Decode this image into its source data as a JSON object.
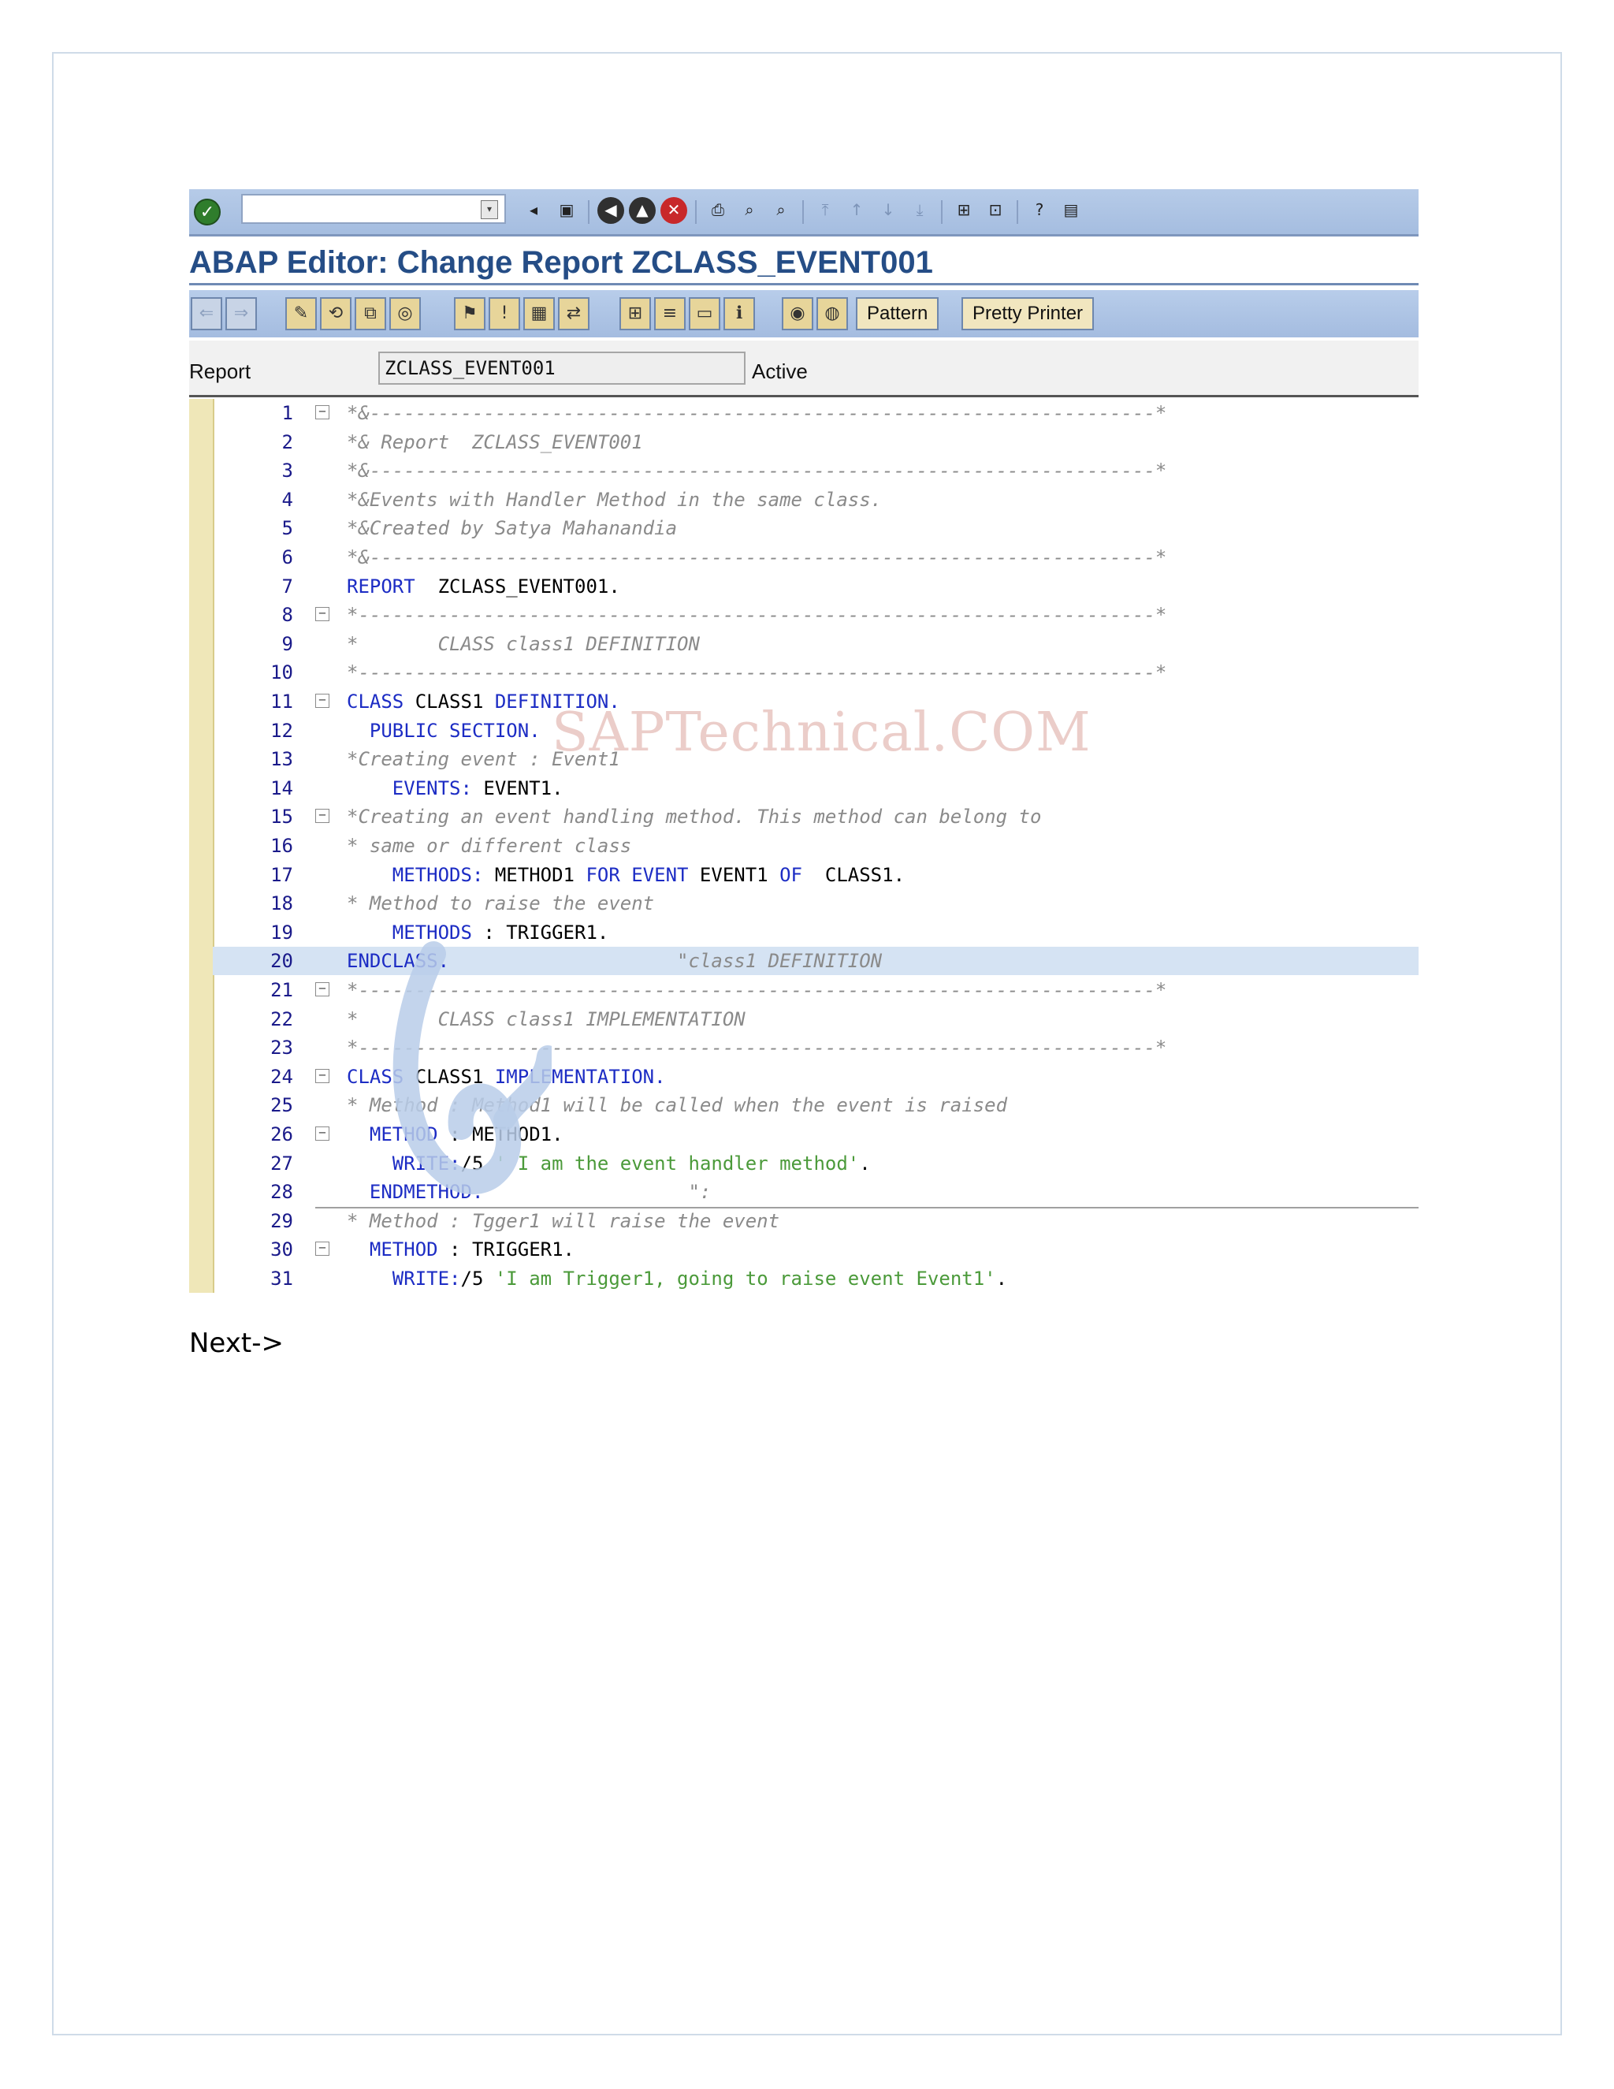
{
  "title": "ABAP Editor: Change Report ZCLASS_EVENT001",
  "toolbar": {
    "pattern_label": "Pattern",
    "pretty_printer_label": "Pretty Printer"
  },
  "report": {
    "label": "Report",
    "name": "ZCLASS_EVENT001",
    "status": "Active"
  },
  "watermark": "SAPTechnical.COM",
  "next_link": "Next->",
  "icons": {
    "system": [
      "enter-icon",
      "command-field-dropdown-icon",
      "back-nav-icon",
      "save-icon",
      "back-icon",
      "exit-icon",
      "cancel-icon",
      "print-icon",
      "find-icon",
      "find-next-icon",
      "first-page-icon",
      "prev-page-icon",
      "next-page-icon",
      "last-page-icon",
      "new-session-icon",
      "shortcut-icon",
      "help-icon",
      "layout-menu-icon"
    ],
    "application": [
      "back-arrow-icon",
      "forward-arrow-icon",
      "display-change-icon",
      "active-inactive-icon",
      "other-object-icon",
      "check-icon",
      "activate-icon",
      "test-icon",
      "where-used-icon",
      "object-list-icon",
      "navigation-window-icon",
      "enhance-icon",
      "breakpoint-icon",
      "set-breakpoint-icon",
      "stop-icon"
    ]
  },
  "colors": {
    "keyword": "#1c2cc4",
    "comment": "#8a8a8a",
    "string": "#4b9a3a",
    "title": "#254d86",
    "toolbar": "#a5bde0"
  },
  "code_lines": [
    {
      "n": "1",
      "fold": "⊟",
      "highlight": false,
      "tokens": [
        {
          "t": "c",
          "s": "*&---------------------------------------------------------------------*"
        }
      ]
    },
    {
      "n": "2",
      "fold": "",
      "highlight": false,
      "tokens": [
        {
          "t": "c",
          "s": "*& Report  ZCLASS_EVENT001"
        }
      ]
    },
    {
      "n": "3",
      "fold": "",
      "highlight": false,
      "tokens": [
        {
          "t": "c",
          "s": "*&---------------------------------------------------------------------*"
        }
      ]
    },
    {
      "n": "4",
      "fold": "",
      "highlight": false,
      "tokens": [
        {
          "t": "c",
          "s": "*&Events with Handler Method in the same class."
        }
      ]
    },
    {
      "n": "5",
      "fold": "",
      "highlight": false,
      "tokens": [
        {
          "t": "c",
          "s": "*&Created by Satya Mahanandia"
        }
      ]
    },
    {
      "n": "6",
      "fold": "",
      "highlight": false,
      "tokens": [
        {
          "t": "c",
          "s": "*&---------------------------------------------------------------------*"
        }
      ]
    },
    {
      "n": "7",
      "fold": "",
      "highlight": false,
      "tokens": [
        {
          "t": "k",
          "s": "REPORT"
        },
        {
          "t": "i",
          "s": "  ZCLASS_EVENT001."
        }
      ]
    },
    {
      "n": "8",
      "fold": "⊟",
      "highlight": false,
      "tokens": [
        {
          "t": "c",
          "s": "*----------------------------------------------------------------------*"
        }
      ]
    },
    {
      "n": "9",
      "fold": "",
      "highlight": false,
      "tokens": [
        {
          "t": "c",
          "s": "*       CLASS class1 DEFINITION"
        }
      ]
    },
    {
      "n": "10",
      "fold": "",
      "highlight": false,
      "tokens": [
        {
          "t": "c",
          "s": "*----------------------------------------------------------------------*"
        }
      ]
    },
    {
      "n": "11",
      "fold": "⊟",
      "highlight": false,
      "tokens": [
        {
          "t": "k",
          "s": "CLASS"
        },
        {
          "t": "i",
          "s": " CLASS1 "
        },
        {
          "t": "k",
          "s": "DEFINITION."
        }
      ]
    },
    {
      "n": "12",
      "fold": "",
      "highlight": false,
      "tokens": [
        {
          "t": "k",
          "s": "  PUBLIC SECTION."
        }
      ]
    },
    {
      "n": "13",
      "fold": "",
      "highlight": false,
      "tokens": [
        {
          "t": "c",
          "s": "*Creating event : Event1"
        }
      ]
    },
    {
      "n": "14",
      "fold": "",
      "highlight": false,
      "tokens": [
        {
          "t": "k",
          "s": "    EVENTS:"
        },
        {
          "t": "i",
          "s": " EVENT1."
        }
      ]
    },
    {
      "n": "15",
      "fold": "⊟",
      "highlight": false,
      "tokens": [
        {
          "t": "c",
          "s": "*Creating an event handling method. This method can belong to"
        }
      ]
    },
    {
      "n": "16",
      "fold": "",
      "highlight": false,
      "tokens": [
        {
          "t": "c",
          "s": "* same or different class"
        }
      ]
    },
    {
      "n": "17",
      "fold": "",
      "highlight": false,
      "tokens": [
        {
          "t": "k",
          "s": "    METHODS:"
        },
        {
          "t": "i",
          "s": " METHOD1 "
        },
        {
          "t": "k",
          "s": "FOR EVENT"
        },
        {
          "t": "i",
          "s": " EVENT1 "
        },
        {
          "t": "k",
          "s": "OF"
        },
        {
          "t": "i",
          "s": "  CLASS1."
        }
      ]
    },
    {
      "n": "18",
      "fold": "",
      "highlight": false,
      "tokens": [
        {
          "t": "c",
          "s": "* Method to raise the event"
        }
      ]
    },
    {
      "n": "19",
      "fold": "",
      "highlight": false,
      "tokens": [
        {
          "t": "k",
          "s": "    METHODS"
        },
        {
          "t": "i",
          "s": " : TRIGGER1."
        }
      ]
    },
    {
      "n": "20",
      "fold": "",
      "highlight": true,
      "tokens": [
        {
          "t": "k",
          "s": "ENDCLASS."
        },
        {
          "t": "i",
          "s": "                    "
        },
        {
          "t": "c",
          "s": "\"class1 DEFINITION"
        }
      ]
    },
    {
      "n": "21",
      "fold": "⊟",
      "highlight": false,
      "tokens": [
        {
          "t": "c",
          "s": "*----------------------------------------------------------------------*"
        }
      ]
    },
    {
      "n": "22",
      "fold": "",
      "highlight": false,
      "tokens": [
        {
          "t": "c",
          "s": "*       CLASS class1 IMPLEMENTATION"
        }
      ]
    },
    {
      "n": "23",
      "fold": "",
      "highlight": false,
      "tokens": [
        {
          "t": "c",
          "s": "*----------------------------------------------------------------------*"
        }
      ]
    },
    {
      "n": "24",
      "fold": "⊟",
      "highlight": false,
      "tokens": [
        {
          "t": "k",
          "s": "CLASS"
        },
        {
          "t": "i",
          "s": " CLASS1 "
        },
        {
          "t": "k",
          "s": "IMPLEMENTATION."
        }
      ]
    },
    {
      "n": "25",
      "fold": "",
      "highlight": false,
      "tokens": [
        {
          "t": "c",
          "s": "* Method : Method1 will be called when the event is raised"
        }
      ]
    },
    {
      "n": "26",
      "fold": "⊟",
      "highlight": false,
      "tokens": [
        {
          "t": "k",
          "s": "  METHOD"
        },
        {
          "t": "i",
          "s": " : METHOD1."
        }
      ]
    },
    {
      "n": "27",
      "fold": "",
      "highlight": false,
      "tokens": [
        {
          "t": "k",
          "s": "    WRITE:"
        },
        {
          "t": "i",
          "s": "/5 "
        },
        {
          "t": "s",
          "s": "' I am the event handler method'"
        },
        {
          "t": "i",
          "s": "."
        }
      ]
    },
    {
      "n": "28",
      "fold": "",
      "highlight": false,
      "tokens": [
        {
          "t": "k",
          "s": "  ENDMETHOD."
        },
        {
          "t": "i",
          "s": "                  "
        },
        {
          "t": "c",
          "s": "\":"
        }
      ]
    },
    {
      "n": "29",
      "fold": "",
      "highlight": false,
      "tokens": [
        {
          "t": "c",
          "s": "* Method : Tgger1 will raise the event"
        }
      ]
    },
    {
      "n": "30",
      "fold": "⊟",
      "highlight": false,
      "tokens": [
        {
          "t": "k",
          "s": "  METHOD"
        },
        {
          "t": "i",
          "s": " : TRIGGER1."
        }
      ]
    },
    {
      "n": "31",
      "fold": "",
      "highlight": false,
      "tokens": [
        {
          "t": "k",
          "s": "    WRITE:"
        },
        {
          "t": "i",
          "s": "/5 "
        },
        {
          "t": "s",
          "s": "'I am Trigger1, going to raise event Event1'"
        },
        {
          "t": "i",
          "s": "."
        }
      ]
    }
  ]
}
